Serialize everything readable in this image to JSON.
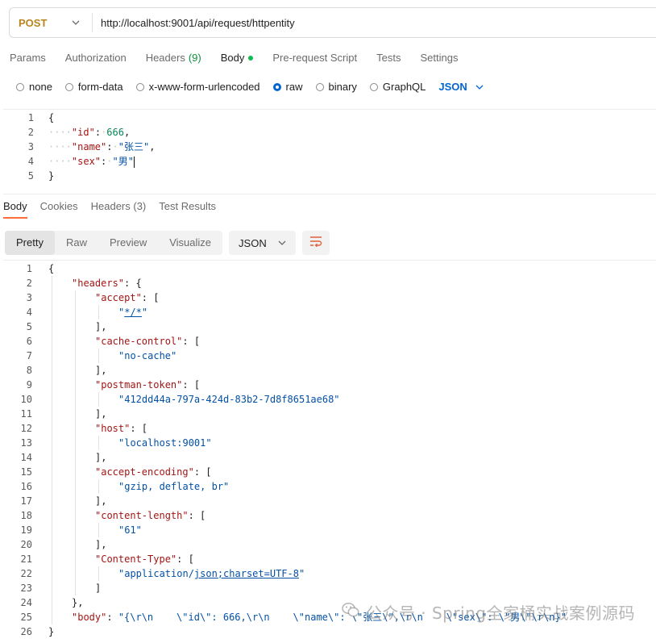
{
  "request": {
    "method": "POST",
    "url": "http://localhost:9001/api/request/httpentity"
  },
  "request_tabs": [
    {
      "label": "Params"
    },
    {
      "label": "Authorization"
    },
    {
      "label": "Headers",
      "count": "(9)"
    },
    {
      "label": "Body"
    },
    {
      "label": "Pre-request Script"
    },
    {
      "label": "Tests"
    },
    {
      "label": "Settings"
    }
  ],
  "body_types": [
    "none",
    "form-data",
    "x-www-form-urlencoded",
    "raw",
    "binary",
    "GraphQL"
  ],
  "selected_body_type": "raw",
  "raw_format": "JSON",
  "request_body_lines": [
    {
      "n": "1",
      "t": "{"
    },
    {
      "n": "2",
      "key": "\"id\"",
      "val": "666",
      "valtype": "num",
      "tail": ","
    },
    {
      "n": "3",
      "key": "\"name\"",
      "val": "\"张三\"",
      "valtype": "str",
      "tail": ","
    },
    {
      "n": "4",
      "key": "\"sex\"",
      "val": "\"男\"",
      "valtype": "str",
      "tail": ""
    },
    {
      "n": "5",
      "t": "}"
    }
  ],
  "response_tabs": [
    "Body",
    "Cookies",
    "Headers (3)",
    "Test Results"
  ],
  "view_modes": [
    "Pretty",
    "Raw",
    "Preview",
    "Visualize"
  ],
  "response_format": "JSON",
  "response_lines": [
    {
      "n": "1",
      "d": 0,
      "parts": [
        [
          "p",
          "{"
        ]
      ]
    },
    {
      "n": "2",
      "d": 1,
      "parts": [
        [
          "k",
          "\"headers\""
        ],
        [
          "p",
          ": {"
        ]
      ]
    },
    {
      "n": "3",
      "d": 2,
      "parts": [
        [
          "k",
          "\"accept\""
        ],
        [
          "p",
          ": ["
        ]
      ]
    },
    {
      "n": "4",
      "d": 3,
      "parts": [
        [
          "s",
          "\""
        ],
        [
          "su",
          "*/*"
        ],
        [
          "s",
          "\""
        ]
      ]
    },
    {
      "n": "5",
      "d": 2,
      "parts": [
        [
          "p",
          "],"
        ]
      ]
    },
    {
      "n": "6",
      "d": 2,
      "parts": [
        [
          "k",
          "\"cache-control\""
        ],
        [
          "p",
          ": ["
        ]
      ]
    },
    {
      "n": "7",
      "d": 3,
      "parts": [
        [
          "s",
          "\"no-cache\""
        ]
      ]
    },
    {
      "n": "8",
      "d": 2,
      "parts": [
        [
          "p",
          "],"
        ]
      ]
    },
    {
      "n": "9",
      "d": 2,
      "parts": [
        [
          "k",
          "\"postman-token\""
        ],
        [
          "p",
          ": ["
        ]
      ]
    },
    {
      "n": "10",
      "d": 3,
      "parts": [
        [
          "s",
          "\"412dd44a-797a-424d-83b2-7d8f8651ae68\""
        ]
      ]
    },
    {
      "n": "11",
      "d": 2,
      "parts": [
        [
          "p",
          "],"
        ]
      ]
    },
    {
      "n": "12",
      "d": 2,
      "parts": [
        [
          "k",
          "\"host\""
        ],
        [
          "p",
          ": ["
        ]
      ]
    },
    {
      "n": "13",
      "d": 3,
      "parts": [
        [
          "s",
          "\"localhost:9001\""
        ]
      ]
    },
    {
      "n": "14",
      "d": 2,
      "parts": [
        [
          "p",
          "],"
        ]
      ]
    },
    {
      "n": "15",
      "d": 2,
      "parts": [
        [
          "k",
          "\"accept-encoding\""
        ],
        [
          "p",
          ": ["
        ]
      ]
    },
    {
      "n": "16",
      "d": 3,
      "parts": [
        [
          "s",
          "\"gzip, deflate, br\""
        ]
      ]
    },
    {
      "n": "17",
      "d": 2,
      "parts": [
        [
          "p",
          "],"
        ]
      ]
    },
    {
      "n": "18",
      "d": 2,
      "parts": [
        [
          "k",
          "\"content-length\""
        ],
        [
          "p",
          ": ["
        ]
      ]
    },
    {
      "n": "19",
      "d": 3,
      "parts": [
        [
          "s",
          "\"61\""
        ]
      ]
    },
    {
      "n": "20",
      "d": 2,
      "parts": [
        [
          "p",
          "],"
        ]
      ]
    },
    {
      "n": "21",
      "d": 2,
      "parts": [
        [
          "k",
          "\"Content-Type\""
        ],
        [
          "p",
          ": ["
        ]
      ]
    },
    {
      "n": "22",
      "d": 3,
      "parts": [
        [
          "s",
          "\"application/"
        ],
        [
          "su",
          "json;charset=UTF-8"
        ],
        [
          "s",
          "\""
        ]
      ]
    },
    {
      "n": "23",
      "d": 2,
      "parts": [
        [
          "p",
          "]"
        ]
      ]
    },
    {
      "n": "24",
      "d": 1,
      "parts": [
        [
          "p",
          "},"
        ]
      ]
    },
    {
      "n": "25",
      "d": 1,
      "parts": [
        [
          "k",
          "\"body\""
        ],
        [
          "p",
          ": "
        ],
        [
          "s",
          "\"{\\r\\n    \\\"id\\\": 666,\\r\\n    \\\"name\\\": \\\"张三\\\",\\r\\n    \\\"sex\\\": \\\"男\\\"\\r\\n}\""
        ]
      ]
    },
    {
      "n": "26",
      "d": 0,
      "parts": [
        [
          "p",
          "}"
        ]
      ]
    }
  ],
  "watermark": "公众号 · Spring全家桶实战案例源码",
  "colors": {
    "method": "#b9841c",
    "accent_blue": "#0265d2",
    "active_tab_underline": "#ff6c37",
    "body_dot": "#0cbb52",
    "json_key": "#a31515",
    "json_string": "#0451a5",
    "json_number": "#098658"
  }
}
